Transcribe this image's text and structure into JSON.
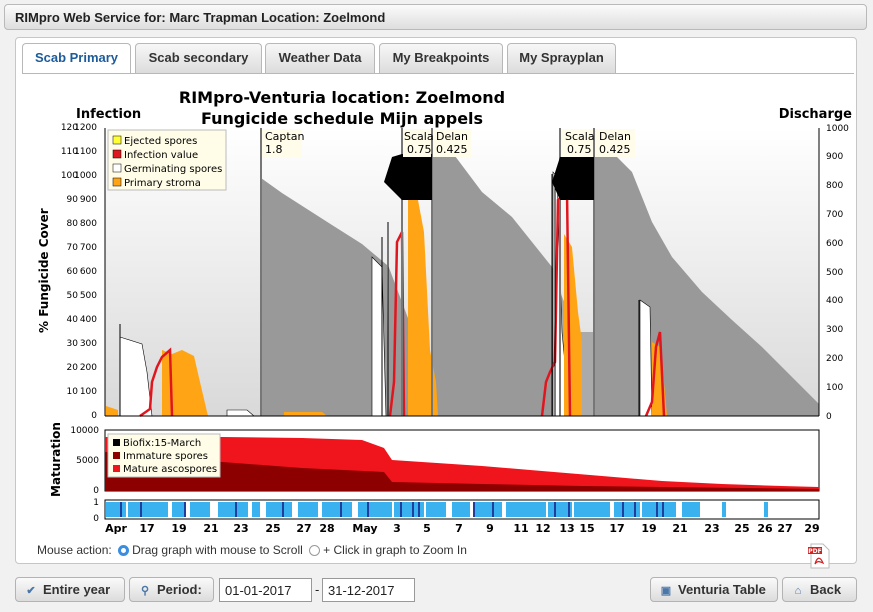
{
  "window_title": "RIMpro Web Service for: Marc Trapman Location: Zoelmond",
  "tabs": [
    {
      "label": "Scab Primary",
      "active": true
    },
    {
      "label": "Scab secondary",
      "active": false
    },
    {
      "label": "Weather Data",
      "active": false
    },
    {
      "label": "My Breakpoints",
      "active": false
    },
    {
      "label": "My Sprayplan",
      "active": false
    }
  ],
  "chart": {
    "title_line1": "RIMpro-Venturia location:  Zoelmond",
    "title_line2": "Fungicide schedule  Mijn appels",
    "left_label": "Infection",
    "right_label": "Discharge",
    "fungicide_axis_label": "% Fungicide Cover",
    "maturation_axis_label": "Maturation",
    "infection_ticks": [
      "0",
      "100",
      "200",
      "300",
      "400",
      "500",
      "600",
      "700",
      "800",
      "900",
      "1000",
      "1100",
      "1200"
    ],
    "fungicide_ticks": [
      "10",
      "20",
      "30",
      "40",
      "50",
      "60",
      "70",
      "80",
      "90",
      "100",
      "110",
      "120"
    ],
    "discharge_ticks": [
      "0",
      "100",
      "200",
      "300",
      "400",
      "500",
      "600",
      "700",
      "800",
      "900",
      "1000"
    ],
    "maturation_ticks": [
      "0",
      "5000",
      "10000"
    ],
    "bottom_ticks": [
      "0",
      "1"
    ],
    "legend_main": [
      "Ejected spores",
      "Infection value",
      "Germinating spores",
      "Primary stroma"
    ],
    "legend_maturation": [
      "Biofix:15-March",
      "Immature spores",
      "Mature ascospores"
    ],
    "sprays": [
      {
        "name": "Captan",
        "dose": "1.8"
      },
      {
        "name": "Scala",
        "dose": "0.75"
      },
      {
        "name": "Delan",
        "dose": "0.425"
      },
      {
        "name": "Scala",
        "dose": "0.75"
      },
      {
        "name": "Delan",
        "dose": "0.425"
      }
    ],
    "x_labels": [
      "Apr",
      "17",
      "19",
      "21",
      "23",
      "25",
      "27",
      "28",
      "May",
      "3",
      "5",
      "7",
      "9",
      "11",
      "12",
      "13",
      "15",
      "17",
      "19",
      "21",
      "23",
      "25",
      "26",
      "27",
      "29"
    ],
    "colors": {
      "stroma": "#ffa515",
      "infection": "#e0161f",
      "cover": "#999999",
      "immature": "#8c0000",
      "mature": "#f0141c",
      "wetness": "#3ab2f0"
    }
  },
  "mouse_action": {
    "label": "Mouse action:",
    "option_scroll": "Drag graph with mouse to Scroll",
    "option_zoom": "+ Click in graph to Zoom In"
  },
  "pdf_icon": "pdf-icon",
  "footer": {
    "entire_year": "Entire year",
    "period": "Period:",
    "date_from": "01-01-2017",
    "date_to": "31-12-2017",
    "venturia_table": "Venturia Table",
    "back": "Back"
  }
}
